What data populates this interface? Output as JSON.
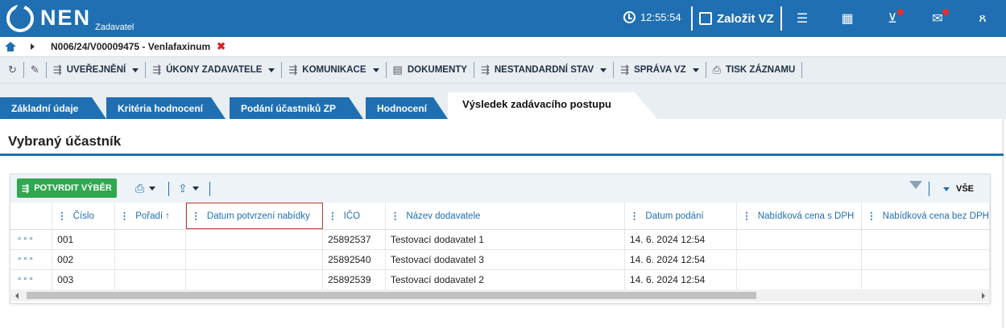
{
  "app": {
    "brand": "NEN",
    "subtitle": "Zadavatel"
  },
  "topbar": {
    "clock": "12:55:54",
    "new_button": "Založit VZ",
    "icons": [
      "clock-icon",
      "edit-icon",
      "menu-icon",
      "calculator-icon",
      "inbox-icon",
      "mail-icon",
      "user-icon"
    ]
  },
  "breadcrumb": {
    "path": "N006/24/V00009475 - Venlafaxinum",
    "close": "✖"
  },
  "toolbar": {
    "items": [
      "UVEŘEJNĚNÍ",
      "ÚKONY ZADAVATELE",
      "KOMUNIKACE",
      "DOKUMENTY",
      "NESTANDARDNÍ STAV",
      "SPRÁVA VZ",
      "TISK ZÁZNAMU"
    ]
  },
  "tabs": [
    "Základní údaje",
    "Kritéria hodnocení",
    "Podání účastníků ZP",
    "Hodnocení",
    "Výsledek zadávacího postupu"
  ],
  "section": {
    "title": "Vybraný účastník"
  },
  "grid": {
    "confirm_label": "POTVRDIT VÝBĚR",
    "filter_label": "VŠE",
    "columns": [
      "Číslo",
      "Pořadí ↑",
      "Datum potvrzení nabídky",
      "IČO",
      "Název dodavatele",
      "Datum podání",
      "Nabídková cena s DPH",
      "Nabídková cena bez DPH"
    ],
    "rows": [
      {
        "more": "∘∘∘",
        "cislo": "001",
        "poradi": "",
        "datum_potvrzeni": "",
        "ico": "25892537",
        "nazev": "Testovací dodavatel 1",
        "datum_podani": "14. 6. 2024 12:54",
        "cena_s": "",
        "cena_bez": ""
      },
      {
        "more": "∘∘∘",
        "cislo": "002",
        "poradi": "",
        "datum_potvrzeni": "",
        "ico": "25892540",
        "nazev": "Testovací dodavatel 3",
        "datum_podani": "14. 6. 2024 12:54",
        "cena_s": "",
        "cena_bez": ""
      },
      {
        "more": "∘∘∘",
        "cislo": "003",
        "poradi": "",
        "datum_potvrzeni": "",
        "ico": "25892539",
        "nazev": "Testovací dodavatel 2",
        "datum_podani": "14. 6. 2024 12:54",
        "cena_s": "",
        "cena_bez": ""
      }
    ]
  },
  "colors": {
    "primary": "#1f6fb2",
    "confirm": "#2fa84f",
    "close": "#e02020"
  }
}
